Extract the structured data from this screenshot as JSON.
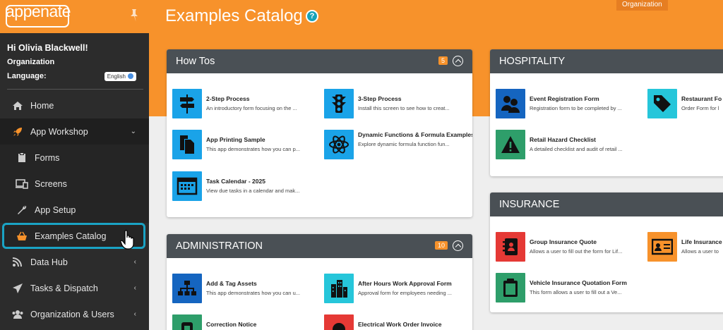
{
  "app": {
    "logo_text": "appenate"
  },
  "user": {
    "greeting": "Hi Olivia Blackwell!",
    "org": "Organization",
    "language_label": "Language:",
    "language_value": "English"
  },
  "nav": [
    {
      "label": "Home",
      "icon": "home-icon"
    },
    {
      "label": "App Workshop",
      "icon": "rocket-icon",
      "expanded": true
    },
    {
      "label": "Forms",
      "icon": "clipboard-icon"
    },
    {
      "label": "Screens",
      "icon": "devices-icon"
    },
    {
      "label": "App Setup",
      "icon": "wrench-icon"
    },
    {
      "label": "Examples Catalog",
      "icon": "basket-icon",
      "selected": true
    },
    {
      "label": "Data Hub",
      "icon": "signal-icon"
    },
    {
      "label": "Tasks & Dispatch",
      "icon": "send-icon"
    },
    {
      "label": "Organization & Users",
      "icon": "users-icon"
    }
  ],
  "header": {
    "title": "Examples Catalog",
    "org_tag": "Organization",
    "help": "?"
  },
  "panels": {
    "howtos": {
      "title": "How Tos",
      "count": "5",
      "items": [
        {
          "title": "2-Step Process",
          "desc": "An introductory form focusing on the ..."
        },
        {
          "title": "3-Step Process",
          "desc": "Install this screen to see how to creat..."
        },
        {
          "title": "App Printing Sample",
          "desc": "This app demonstrates how you can p..."
        },
        {
          "title": "Dynamic Functions & Formula Examples",
          "desc": "Explore dynamic formula function fun..."
        },
        {
          "title": "Task Calendar - 2025",
          "desc": "View due tasks in a calendar and mak..."
        }
      ]
    },
    "admin": {
      "title": "ADMINISTRATION",
      "count": "10",
      "items": [
        {
          "title": "Add & Tag Assets",
          "desc": "This app demonstrates how you can u..."
        },
        {
          "title": "After Hours Work Approval Form",
          "desc": "Approval form for employees needing ..."
        },
        {
          "title": "Correction Notice",
          "desc": ""
        },
        {
          "title": "Electrical Work Order Invoice",
          "desc": ""
        }
      ]
    },
    "hospitality": {
      "title": "HOSPITALITY",
      "items": [
        {
          "title": "Event Registration Form",
          "desc": "Registration form to be completed by ..."
        },
        {
          "title": "Restaurant Fo",
          "desc": "Order Form for l"
        },
        {
          "title": "Retail Hazard Checklist",
          "desc": "A detailed checklist and audit of retail ..."
        }
      ]
    },
    "insurance": {
      "title": "INSURANCE",
      "items": [
        {
          "title": "Group Insurance Quote",
          "desc": "Allows a user to fill out the form for Lif..."
        },
        {
          "title": "Life Insurance",
          "desc": "Allows a user to"
        },
        {
          "title": "Vehicle Insurance Quotation Form",
          "desc": "This form allows a user to fill out a Ve..."
        }
      ]
    }
  },
  "colors": {
    "accent": "#f7922b",
    "sidebar": "#2c2c2c",
    "panel_header": "#4a5055",
    "selected_border": "#1aa3c4"
  }
}
